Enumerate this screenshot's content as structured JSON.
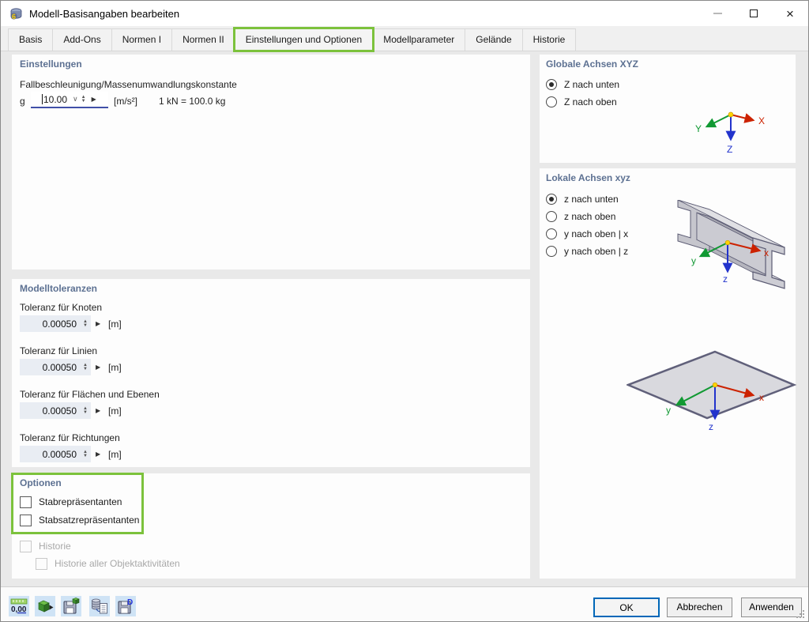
{
  "window": {
    "title": "Modell-Basisangaben bearbeiten"
  },
  "titlebar": {
    "app_icon": "rfem-model-icon",
    "controls": [
      "minimize-icon",
      "maximize-icon",
      "close-icon"
    ]
  },
  "tabs": [
    {
      "label": "Basis",
      "active": false
    },
    {
      "label": "Add-Ons",
      "active": false
    },
    {
      "label": "Normen I",
      "active": false
    },
    {
      "label": "Normen II",
      "active": false
    },
    {
      "label": "Einstellungen und Optionen",
      "active": true,
      "highlighted": true
    },
    {
      "label": "Modellparameter",
      "active": false
    },
    {
      "label": "Gelände",
      "active": false
    },
    {
      "label": "Historie",
      "active": false
    }
  ],
  "settings_panel": {
    "title": "Einstellungen",
    "gravity_label": "Fallbeschleunigung/Massenumwandlungskonstante",
    "g_symbol": "g",
    "g_value": "10.00",
    "g_unit": "[m/s²]",
    "conversion_note": "1 kN = 100.0 kg"
  },
  "tolerances_panel": {
    "title": "Modelltoleranzen",
    "items": [
      {
        "label": "Toleranz für Knoten",
        "value": "0.00050",
        "unit": "[m]"
      },
      {
        "label": "Toleranz für Linien",
        "value": "0.00050",
        "unit": "[m]"
      },
      {
        "label": "Toleranz für Flächen und Ebenen",
        "value": "0.00050",
        "unit": "[m]"
      },
      {
        "label": "Toleranz für Richtungen",
        "value": "0.00050",
        "unit": "[m]"
      }
    ]
  },
  "options_panel": {
    "title": "Optionen",
    "checkboxes": [
      {
        "label": "Stabrepräsentanten",
        "checked": false
      },
      {
        "label": "Stabsatzrepräsentanten",
        "checked": false
      }
    ],
    "history": {
      "label": "Historie",
      "checked": false,
      "enabled": false
    },
    "history_sub": {
      "label": "Historie aller Objektaktivitäten",
      "checked": false,
      "enabled": false
    }
  },
  "global_axes_panel": {
    "title": "Globale Achsen XYZ",
    "options": [
      {
        "label": "Z nach unten",
        "selected": true
      },
      {
        "label": "Z nach oben",
        "selected": false
      }
    ],
    "axes": {
      "x": "X",
      "y": "Y",
      "z": "Z"
    }
  },
  "local_axes_panel": {
    "title": "Lokale Achsen xyz",
    "options": [
      {
        "label": "z nach unten",
        "selected": true
      },
      {
        "label": "z nach oben",
        "selected": false
      },
      {
        "label": "y nach oben | x",
        "selected": false
      },
      {
        "label": "y nach oben | z",
        "selected": false
      }
    ],
    "axes": {
      "x": "x",
      "y": "y",
      "z": "z"
    }
  },
  "footer": {
    "ok_label": "OK",
    "cancel_label": "Abbrechen",
    "apply_label": "Anwenden",
    "units_icon_text": "0,00",
    "toolbar_icons": [
      "decimal-places-icon",
      "apply-parameters-icon",
      "save-as-template-icon",
      "copy-from-model-icon",
      "save-as-default-icon"
    ]
  },
  "colors": {
    "header_blue": "#5d7192",
    "highlight_green": "#7cc23c",
    "accent_blue": "#0067b8",
    "field_bg": "#e9edf3",
    "focus_underline": "#4050a8",
    "axis_x_red": "#cc2200",
    "axis_y_green": "#119933",
    "axis_z_blue": "#2233cc"
  }
}
